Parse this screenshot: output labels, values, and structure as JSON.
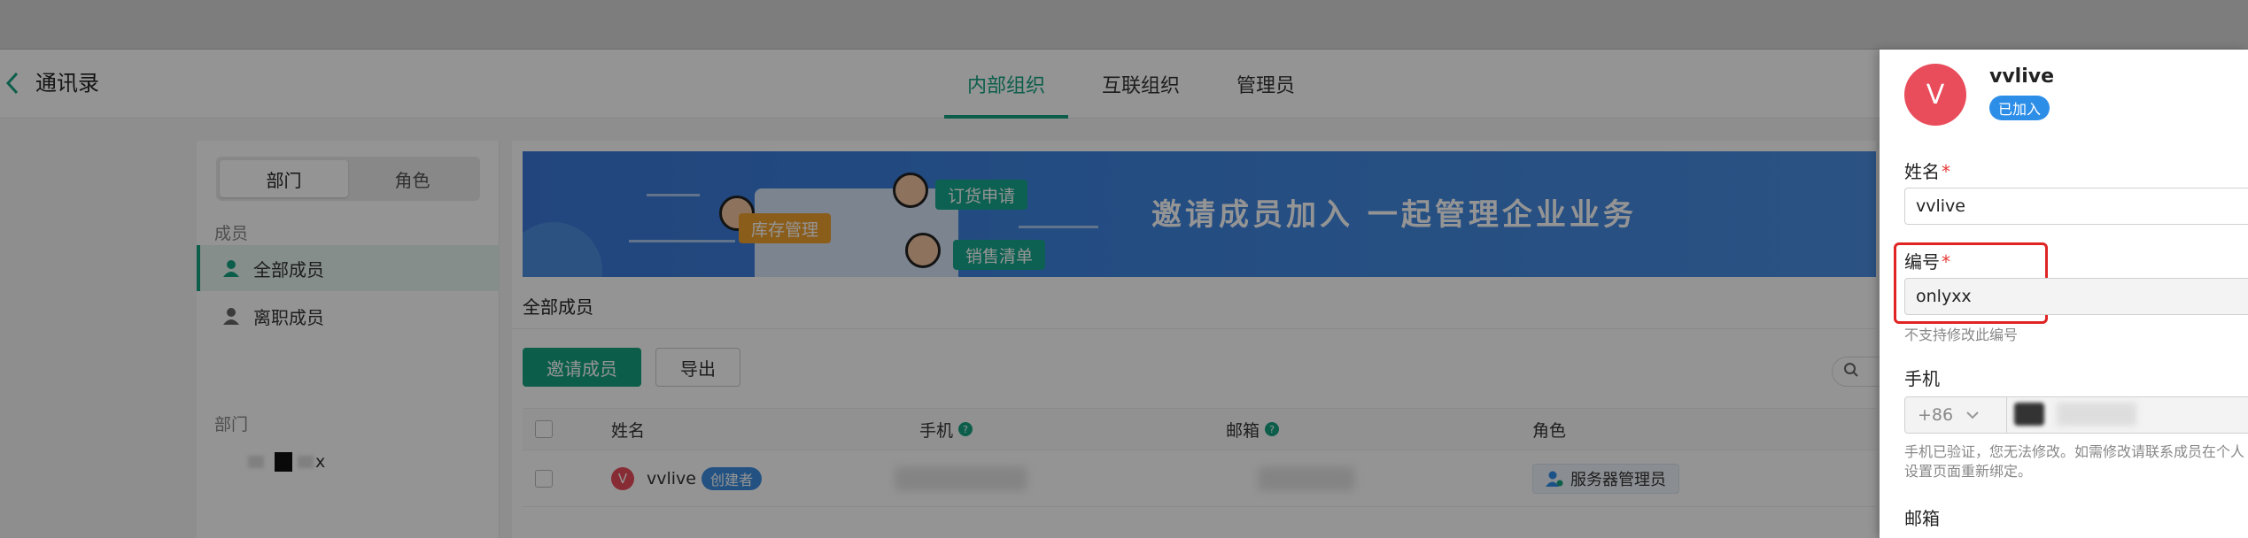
{
  "header": {
    "title": "通讯录",
    "tabs": [
      {
        "label": "内部组织",
        "active": true
      },
      {
        "label": "互联组织",
        "active": false
      },
      {
        "label": "管理员",
        "active": false
      }
    ]
  },
  "sidebar": {
    "segments": [
      {
        "label": "部门",
        "active": true
      },
      {
        "label": "角色",
        "active": false
      }
    ],
    "members_label": "成员",
    "items": [
      {
        "label": "全部成员",
        "active": true
      },
      {
        "label": "离职成员",
        "active": false
      }
    ],
    "dept_label": "部门",
    "dept_item_suffix": "x"
  },
  "banner": {
    "headline": "邀请成员加入 一起管理企业业务",
    "tags": [
      "订货申请",
      "库存管理",
      "销售清单"
    ]
  },
  "main": {
    "section_title": "全部成员",
    "invite_label": "邀请成员",
    "export_label": "导出",
    "columns": [
      "姓名",
      "手机",
      "邮箱",
      "角色"
    ],
    "rows": [
      {
        "avatar": "V",
        "name": "vvlive",
        "badge": "创建者",
        "role": "服务器管理员"
      }
    ]
  },
  "drawer": {
    "avatar": "V",
    "name": "vvlive",
    "status": "已加入",
    "fields": {
      "name_label": "姓名",
      "name_value": "vvlive",
      "code_label": "编号",
      "code_value": "onlyxx",
      "code_hint": "不支持修改此编号",
      "phone_label": "手机",
      "country_code": "+86",
      "phone_hint": "手机已验证，您无法修改。如需修改请联系成员在个人设置页面重新绑定。",
      "email_label": "邮箱"
    }
  },
  "colors": {
    "accent": "#15a282",
    "badge_blue": "#2d8ee8",
    "avatar_red": "#e94c5a",
    "highlight": "#e02424"
  }
}
